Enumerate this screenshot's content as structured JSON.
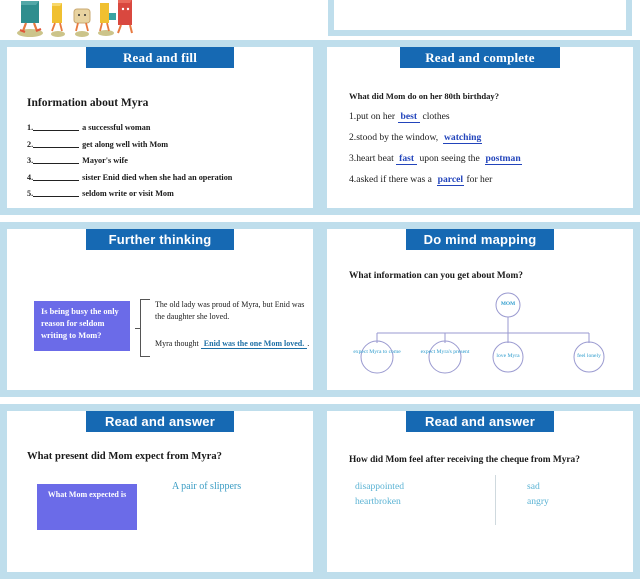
{
  "illustration": {
    "name": "walking-characters-illustration",
    "alt": "cartoon books and envelopes with legs walking"
  },
  "panels": {
    "read_and_fill": {
      "header": "Read and fill",
      "question": "Information about Myra",
      "items": [
        {
          "num": "1.",
          "text": "a successful woman"
        },
        {
          "num": "2.",
          "text": "get along well with Mom"
        },
        {
          "num": "3.",
          "text": "Mayor's wife"
        },
        {
          "num": "4.",
          "text": "sister Enid died when she had an operation"
        },
        {
          "num": "5.",
          "text": "seldom write or visit Mom"
        }
      ]
    },
    "read_and_complete": {
      "header": "Read and complete",
      "question": "What did Mom do on her 80th birthday?",
      "lines": [
        {
          "pre": "1.put on her",
          "answer": "best",
          "post": "clothes"
        },
        {
          "pre": "2.stood by the window,",
          "answer": "watching",
          "post": ""
        },
        {
          "pre": "3.heart beat",
          "answer": "fast",
          "post": "upon seeing the",
          "answer2": "postman"
        },
        {
          "pre": "4.asked if there was a",
          "answer": "parcel",
          "post": "for her"
        }
      ]
    },
    "further_thinking": {
      "header": "Further thinking",
      "question_box": "Is being busy the only reason for seldom writing to Mom?",
      "bullet1": "The old lady was proud of Myra, but Enid was the daughter she loved.",
      "bullet2_pre": "Myra thought",
      "bullet2_answer": "Enid was the one Mom loved.",
      "bullet2_post": "."
    },
    "do_mind_mapping": {
      "header": "Do mind mapping",
      "question": "What information can you get about Mom?",
      "root": "MOM",
      "children": [
        "expect Myra to come",
        "expect Myra's present",
        "love Myra",
        "feel lonely"
      ]
    },
    "read_and_answer_left": {
      "header": "Read and answer",
      "question": "What present did Mom expect from Myra?",
      "box": "What Mom expected is",
      "options": [
        "A pair of slippers"
      ]
    },
    "read_and_answer_right": {
      "header": "Read and answer",
      "question": "How did Mom feel after receiving the cheque from Myra?",
      "column_a": [
        "disappointed",
        "heartbroken"
      ],
      "column_b": [
        "sad",
        "angry"
      ]
    }
  },
  "colors": {
    "header_blue": "#1669b3",
    "frame_blue": "#bfdeec",
    "purple_box": "#6b6be8",
    "answer_blue": "#2244bb",
    "teal_text": "#3a9cc4"
  }
}
